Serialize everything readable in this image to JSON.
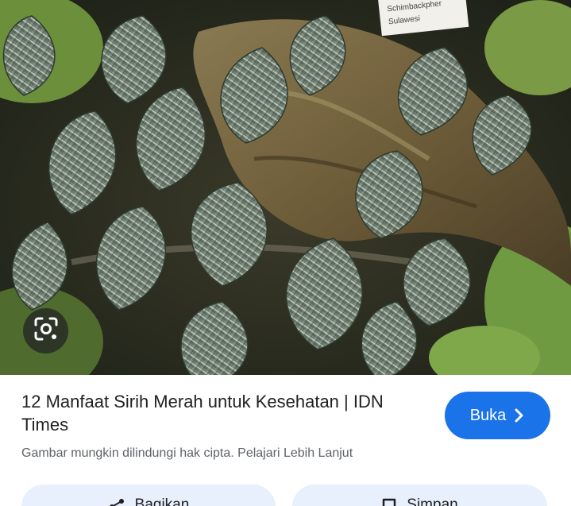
{
  "result": {
    "title": "12 Manfaat Sirih Merah untuk Kesehatan | IDN Times",
    "copyright_notice": "Gambar mungkin dilindungi hak cipta.",
    "learn_more_link": "Pelajari Lebih Lanjut",
    "open_button_label": "Buka"
  },
  "photo": {
    "sign_text_line1": "Schimbackpher",
    "sign_text_line2": "Sulawesi"
  },
  "actions": {
    "share_label": "Bagikan",
    "save_label": "Simpan"
  },
  "icons": {
    "lens": "lens-icon",
    "chevron": "chevron-right-icon",
    "share": "share-icon",
    "save": "bookmark-icon"
  },
  "colors": {
    "primary_button": "#1a73e8",
    "action_button_bg": "#e8f0fe",
    "title_text": "#202124",
    "secondary_text": "#5f6368"
  }
}
